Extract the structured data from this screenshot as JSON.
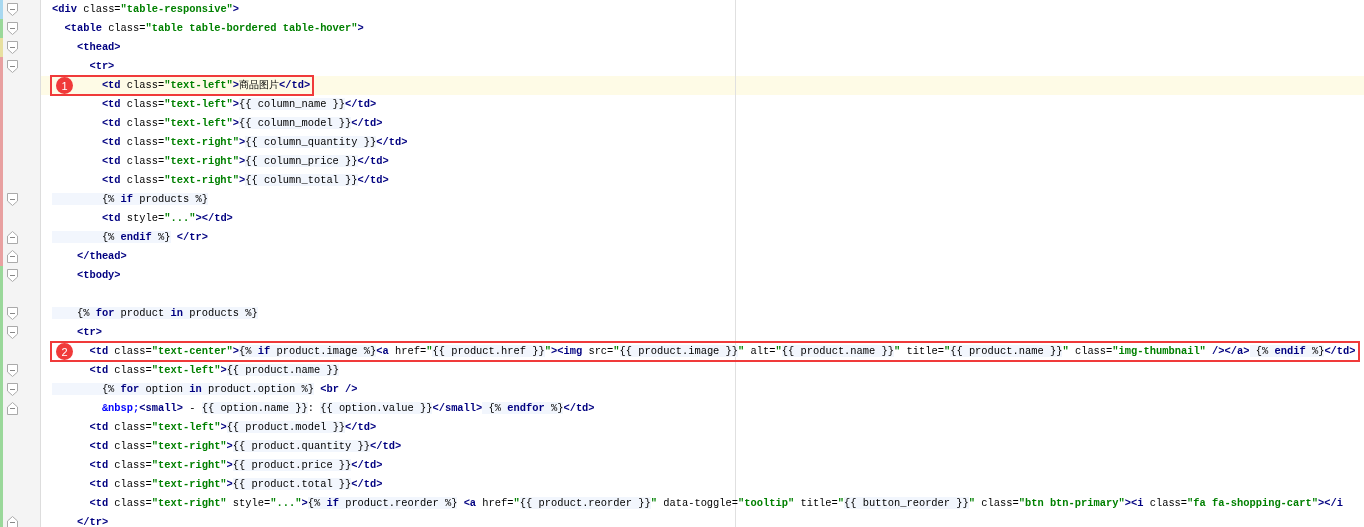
{
  "editor": {
    "lines": [
      {
        "fold_start": true,
        "fold_end": false,
        "color": "#a8d8f0",
        "tokens": [
          {
            "kind": "tag",
            "text": "<div"
          },
          {
            "kind": "attr",
            "text": " class="
          },
          {
            "kind": "str",
            "text": "\"table-responsive\""
          },
          {
            "kind": "tag",
            "text": ">"
          }
        ]
      },
      {
        "fold_start": true,
        "fold_end": false,
        "color": "#9ad89a",
        "tokens": [
          {
            "kind": "tag",
            "text": "  <table"
          },
          {
            "kind": "attr",
            "text": " class="
          },
          {
            "kind": "str",
            "text": "\"table table-bordered table-hover\""
          },
          {
            "kind": "tag",
            "text": ">"
          }
        ]
      },
      {
        "fold_start": true,
        "fold_end": false,
        "color": "#e8e0a0",
        "tokens": [
          {
            "kind": "tag",
            "text": "    <thead>"
          }
        ]
      },
      {
        "fold_start": true,
        "fold_end": false,
        "color": "#e8a0a0",
        "tokens": [
          {
            "kind": "tag",
            "text": "      <tr>"
          }
        ]
      },
      {
        "fold_start": false,
        "fold_end": false,
        "color": "#e8a0a0",
        "current": true,
        "marker": "1",
        "tokens": [
          {
            "kind": "tag",
            "text": "        <td"
          },
          {
            "kind": "attr",
            "text": " class="
          },
          {
            "kind": "str",
            "text": "\"text-left\""
          },
          {
            "kind": "tag",
            "text": ">"
          },
          {
            "kind": "attr",
            "text": "商品图片"
          },
          {
            "kind": "tag",
            "text": "</td>"
          }
        ]
      },
      {
        "fold_start": false,
        "fold_end": false,
        "color": "#e8a0a0",
        "tokens": [
          {
            "kind": "tag",
            "text": "        <td"
          },
          {
            "kind": "attr",
            "text": " class="
          },
          {
            "kind": "str",
            "text": "\"text-left\""
          },
          {
            "kind": "tag",
            "text": ">"
          },
          {
            "kind": "tpl",
            "text": "{{ column_name }}"
          },
          {
            "kind": "tag",
            "text": "</td>"
          }
        ]
      },
      {
        "fold_start": false,
        "fold_end": false,
        "color": "#e8a0a0",
        "tokens": [
          {
            "kind": "tag",
            "text": "        <td"
          },
          {
            "kind": "attr",
            "text": " class="
          },
          {
            "kind": "str",
            "text": "\"text-left\""
          },
          {
            "kind": "tag",
            "text": ">"
          },
          {
            "kind": "tpl",
            "text": "{{ column_model }}"
          },
          {
            "kind": "tag",
            "text": "</td>"
          }
        ]
      },
      {
        "fold_start": false,
        "fold_end": false,
        "color": "#e8a0a0",
        "tokens": [
          {
            "kind": "tag",
            "text": "        <td"
          },
          {
            "kind": "attr",
            "text": " class="
          },
          {
            "kind": "str",
            "text": "\"text-right\""
          },
          {
            "kind": "tag",
            "text": ">"
          },
          {
            "kind": "tpl",
            "text": "{{ column_quantity }}"
          },
          {
            "kind": "tag",
            "text": "</td>"
          }
        ]
      },
      {
        "fold_start": false,
        "fold_end": false,
        "color": "#e8a0a0",
        "tokens": [
          {
            "kind": "tag",
            "text": "        <td"
          },
          {
            "kind": "attr",
            "text": " class="
          },
          {
            "kind": "str",
            "text": "\"text-right\""
          },
          {
            "kind": "tag",
            "text": ">"
          },
          {
            "kind": "tpl",
            "text": "{{ column_price }}"
          },
          {
            "kind": "tag",
            "text": "</td>"
          }
        ]
      },
      {
        "fold_start": false,
        "fold_end": false,
        "color": "#e8a0a0",
        "tokens": [
          {
            "kind": "tag",
            "text": "        <td"
          },
          {
            "kind": "attr",
            "text": " class="
          },
          {
            "kind": "str",
            "text": "\"text-right\""
          },
          {
            "kind": "tag",
            "text": ">"
          },
          {
            "kind": "tpl",
            "text": "{{ column_total }}"
          },
          {
            "kind": "tag",
            "text": "</td>"
          }
        ]
      },
      {
        "fold_start": true,
        "fold_end": false,
        "color": "#e8a0a0",
        "tokens": [
          {
            "kind": "tpl",
            "text": "        {% "
          },
          {
            "kind": "kw",
            "text": "if"
          },
          {
            "kind": "tpl",
            "text": " products %}"
          }
        ]
      },
      {
        "fold_start": false,
        "fold_end": false,
        "color": "#e8a0a0",
        "tokens": [
          {
            "kind": "tag",
            "text": "        <td"
          },
          {
            "kind": "attr",
            "text": " style="
          },
          {
            "kind": "str",
            "text": "\"...\""
          },
          {
            "kind": "tag",
            "text": "></td>"
          }
        ]
      },
      {
        "fold_start": false,
        "fold_end": true,
        "color": "#e8a0a0",
        "tokens": [
          {
            "kind": "tpl",
            "text": "        {% "
          },
          {
            "kind": "kw",
            "text": "endif"
          },
          {
            "kind": "tpl",
            "text": " %}"
          },
          {
            "kind": "tag",
            "text": " </tr>"
          }
        ]
      },
      {
        "fold_start": false,
        "fold_end": true,
        "color": "#e8a0a0",
        "tokens": [
          {
            "kind": "tag",
            "text": "    </thead>"
          }
        ]
      },
      {
        "fold_start": true,
        "fold_end": false,
        "color": "#9ad89a",
        "tokens": [
          {
            "kind": "tag",
            "text": "    <tbody>"
          }
        ]
      },
      {
        "fold_start": false,
        "fold_end": false,
        "color": "#9ad89a"
      },
      {
        "fold_start": true,
        "fold_end": false,
        "color": "#9ad89a",
        "tokens": [
          {
            "kind": "tpl",
            "text": "    {% "
          },
          {
            "kind": "kw",
            "text": "for"
          },
          {
            "kind": "tpl",
            "text": " product "
          },
          {
            "kind": "kw",
            "text": "in"
          },
          {
            "kind": "tpl",
            "text": " products %}"
          }
        ]
      },
      {
        "fold_start": true,
        "fold_end": false,
        "color": "#9ad89a",
        "tokens": [
          {
            "kind": "tag",
            "text": "    <tr>"
          }
        ]
      },
      {
        "fold_start": false,
        "fold_end": false,
        "color": "#9ad89a",
        "marker": "2",
        "tokens": [
          {
            "kind": "tag",
            "text": "      <td"
          },
          {
            "kind": "attr",
            "text": " class="
          },
          {
            "kind": "str",
            "text": "\"text-center\""
          },
          {
            "kind": "tag",
            "text": ">"
          },
          {
            "kind": "tpl",
            "text": "{% "
          },
          {
            "kind": "kw",
            "text": "if"
          },
          {
            "kind": "tpl",
            "text": " product.image %}"
          },
          {
            "kind": "tag",
            "text": "<a"
          },
          {
            "kind": "attr",
            "text": " href="
          },
          {
            "kind": "str",
            "text": "\""
          },
          {
            "kind": "tpl",
            "text": "{{ product.href }}"
          },
          {
            "kind": "str",
            "text": "\""
          },
          {
            "kind": "tag",
            "text": "><img"
          },
          {
            "kind": "attr",
            "text": " src="
          },
          {
            "kind": "str",
            "text": "\""
          },
          {
            "kind": "tpl",
            "text": "{{ product.image }}"
          },
          {
            "kind": "str",
            "text": "\""
          },
          {
            "kind": "attr",
            "text": " alt="
          },
          {
            "kind": "str",
            "text": "\""
          },
          {
            "kind": "tpl",
            "text": "{{ product.name }}"
          },
          {
            "kind": "str",
            "text": "\""
          },
          {
            "kind": "attr",
            "text": " title="
          },
          {
            "kind": "str",
            "text": "\""
          },
          {
            "kind": "tpl",
            "text": "{{ product.name }}"
          },
          {
            "kind": "str",
            "text": "\""
          },
          {
            "kind": "attr",
            "text": " class="
          },
          {
            "kind": "str",
            "text": "\"img-thumbnail\""
          },
          {
            "kind": "tag",
            "text": " /></a>"
          },
          {
            "kind": "tpl",
            "text": " {% "
          },
          {
            "kind": "kw",
            "text": "endif"
          },
          {
            "kind": "tpl",
            "text": " %}"
          },
          {
            "kind": "tag",
            "text": "</td>"
          }
        ]
      },
      {
        "fold_start": true,
        "fold_end": false,
        "color": "#9ad89a",
        "tokens": [
          {
            "kind": "tag",
            "text": "      <td"
          },
          {
            "kind": "attr",
            "text": " class="
          },
          {
            "kind": "str",
            "text": "\"text-left\""
          },
          {
            "kind": "tag",
            "text": ">"
          },
          {
            "kind": "tpl",
            "text": "{{ product.name }}"
          }
        ]
      },
      {
        "fold_start": true,
        "fold_end": false,
        "color": "#9ad89a",
        "tokens": [
          {
            "kind": "tpl",
            "text": "        {% "
          },
          {
            "kind": "kw",
            "text": "for"
          },
          {
            "kind": "tpl",
            "text": " option "
          },
          {
            "kind": "kw",
            "text": "in"
          },
          {
            "kind": "tpl",
            "text": " product.option %}"
          },
          {
            "kind": "tag",
            "text": " <br />"
          }
        ]
      },
      {
        "fold_start": false,
        "fold_end": true,
        "color": "#9ad89a",
        "tokens": [
          {
            "kind": "ent",
            "text": "        &nbsp;"
          },
          {
            "kind": "tag",
            "text": "<small>"
          },
          {
            "kind": "attr",
            "text": " - "
          },
          {
            "kind": "tpl",
            "text": "{{ option.name }}"
          },
          {
            "kind": "attr",
            "text": ": "
          },
          {
            "kind": "tpl",
            "text": "{{ option.value }}"
          },
          {
            "kind": "tag",
            "text": "</small>"
          },
          {
            "kind": "tpl",
            "text": " {% "
          },
          {
            "kind": "kw",
            "text": "endfor"
          },
          {
            "kind": "tpl",
            "text": " %}"
          },
          {
            "kind": "tag",
            "text": "</td>"
          }
        ]
      },
      {
        "fold_start": false,
        "fold_end": false,
        "color": "#9ad89a",
        "tokens": [
          {
            "kind": "tag",
            "text": "      <td"
          },
          {
            "kind": "attr",
            "text": " class="
          },
          {
            "kind": "str",
            "text": "\"text-left\""
          },
          {
            "kind": "tag",
            "text": ">"
          },
          {
            "kind": "tpl",
            "text": "{{ product.model }}"
          },
          {
            "kind": "tag",
            "text": "</td>"
          }
        ]
      },
      {
        "fold_start": false,
        "fold_end": false,
        "color": "#9ad89a",
        "tokens": [
          {
            "kind": "tag",
            "text": "      <td"
          },
          {
            "kind": "attr",
            "text": " class="
          },
          {
            "kind": "str",
            "text": "\"text-right\""
          },
          {
            "kind": "tag",
            "text": ">"
          },
          {
            "kind": "tpl",
            "text": "{{ product.quantity }}"
          },
          {
            "kind": "tag",
            "text": "</td>"
          }
        ]
      },
      {
        "fold_start": false,
        "fold_end": false,
        "color": "#9ad89a",
        "tokens": [
          {
            "kind": "tag",
            "text": "      <td"
          },
          {
            "kind": "attr",
            "text": " class="
          },
          {
            "kind": "str",
            "text": "\"text-right\""
          },
          {
            "kind": "tag",
            "text": ">"
          },
          {
            "kind": "tpl",
            "text": "{{ product.price }}"
          },
          {
            "kind": "tag",
            "text": "</td>"
          }
        ]
      },
      {
        "fold_start": false,
        "fold_end": false,
        "color": "#9ad89a",
        "tokens": [
          {
            "kind": "tag",
            "text": "      <td"
          },
          {
            "kind": "attr",
            "text": " class="
          },
          {
            "kind": "str",
            "text": "\"text-right\""
          },
          {
            "kind": "tag",
            "text": ">"
          },
          {
            "kind": "tpl",
            "text": "{{ product.total }}"
          },
          {
            "kind": "tag",
            "text": "</td>"
          }
        ]
      },
      {
        "fold_start": false,
        "fold_end": false,
        "color": "#9ad89a",
        "tokens": [
          {
            "kind": "tag",
            "text": "      <td"
          },
          {
            "kind": "attr",
            "text": " class="
          },
          {
            "kind": "str",
            "text": "\"text-right\""
          },
          {
            "kind": "attr",
            "text": " style="
          },
          {
            "kind": "str",
            "text": "\"...\""
          },
          {
            "kind": "tag",
            "text": ">"
          },
          {
            "kind": "tpl",
            "text": "{% "
          },
          {
            "kind": "kw",
            "text": "if"
          },
          {
            "kind": "tpl",
            "text": " product.reorder %}"
          },
          {
            "kind": "tag",
            "text": " <a"
          },
          {
            "kind": "attr",
            "text": " href="
          },
          {
            "kind": "str",
            "text": "\""
          },
          {
            "kind": "tpl",
            "text": "{{ product.reorder }}"
          },
          {
            "kind": "str",
            "text": "\""
          },
          {
            "kind": "attr",
            "text": " data-toggle="
          },
          {
            "kind": "str",
            "text": "\"tooltip\""
          },
          {
            "kind": "attr",
            "text": " title="
          },
          {
            "kind": "str",
            "text": "\""
          },
          {
            "kind": "tpl",
            "text": "{{ button_reorder }}"
          },
          {
            "kind": "str",
            "text": "\""
          },
          {
            "kind": "attr",
            "text": " class="
          },
          {
            "kind": "str",
            "text": "\"btn btn-primary\""
          },
          {
            "kind": "tag",
            "text": "><i"
          },
          {
            "kind": "attr",
            "text": " class="
          },
          {
            "kind": "str",
            "text": "\"fa fa-shopping-cart\""
          },
          {
            "kind": "tag",
            "text": "></i"
          }
        ]
      },
      {
        "fold_start": false,
        "fold_end": true,
        "color": "#9ad89a",
        "tokens": [
          {
            "kind": "tag",
            "text": "    </tr>"
          }
        ]
      }
    ]
  }
}
